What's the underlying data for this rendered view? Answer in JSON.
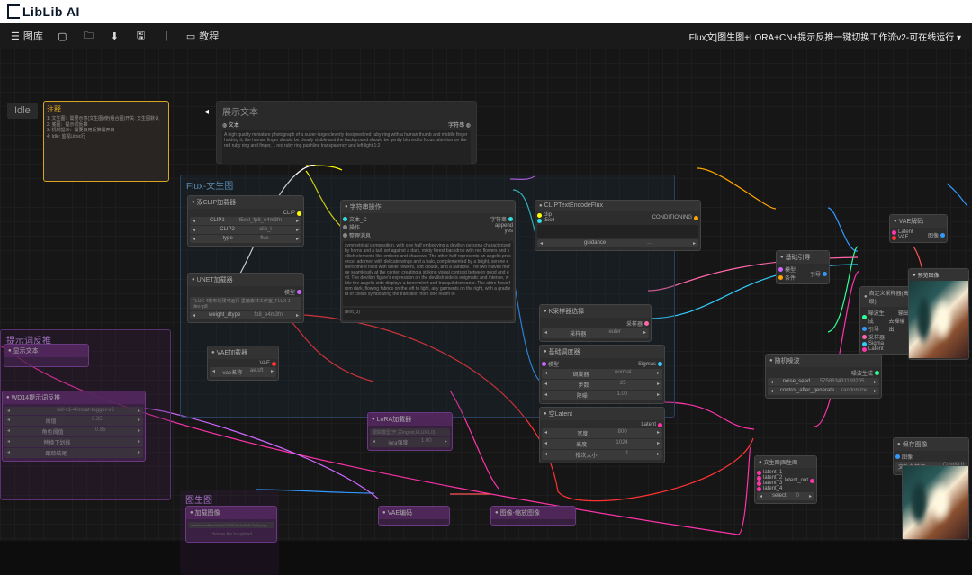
{
  "brand": "LibLib AI",
  "toolbar": {
    "gallery": "图库",
    "tutorial": "教程",
    "title": "Flux文|图生图+LORA+CN+提示反推一键切换工作流v2-可在线运行 ▾"
  },
  "idle": "Idle",
  "notes": {
    "head": "注释",
    "body": "1: 文生图：需要示意(文生图)使(组合图)开关: 文生图默认\n2: 底图：提示词反推\n3: 机制提示：需要启用反推需开启\n4: Idle: 监视Lithic行"
  },
  "display": {
    "title": "展示文本",
    "label": "文本",
    "out": "字符串 ◍",
    "text": "A high quality miniature photograph of a super-large cleverly designed red ruby ring with a human thumb and middle finger holding it, the human finger should be clearly visible and the background should be gently blurred to focus attention on the red ruby ring and finger, 1 red ruby ring pushline transparency and left light,1:2"
  },
  "group": {
    "flux": "Flux-文生图",
    "refl": "提示词反推",
    "imggen": "图生图"
  },
  "clip": {
    "title": "双CLIP加载器",
    "r": "CLIP",
    "rows": [
      [
        "CLIP1",
        "t5xxl_fp8_e4m3fn"
      ],
      [
        "CLIP2",
        "clip_l"
      ],
      [
        "type",
        "flux"
      ]
    ]
  },
  "unet": {
    "title": "UNET加载器",
    "r": "模型",
    "rows": [
      [
        "FLUX-4敬布花残可运行-墨暗森林工作室_FLUX 1-dev-fp8"
      ],
      [
        "weight_dtype",
        "fp8_e4m3fn"
      ]
    ]
  },
  "vae": {
    "title": "VAE加载器",
    "r": "VAE",
    "row": [
      "vae名称",
      "ae.sft"
    ]
  },
  "strop": {
    "title": "字符串操作",
    "out": "字符串",
    "rows": [
      [
        "文本_C",
        ""
      ],
      [
        "操作",
        "append"
      ],
      [
        "整理消息",
        "yes"
      ]
    ],
    "prompt": "symmetrical composition, with one half embodying a devilish persona characterized by horns and a tail, set against a dark, misty forest backdrop with red flowers and hellish elements like embers and shadows. The other half represents an angelic presence, adorned with delicate wings and a halo, complemented by a bright, serene environment filled with white flowers, soft clouds, and a rainbow. The two halves merge seamlessly at the center, creating a striking visual contrast between good and evil. The devilish figure's expression on the devilish side is enigmatic and intense, while the angelic side displays a benevolent and tranquil demeanor. The attire flows from dark, flowing fabrics on the left to light, airy garments on the right, with a gradient of colors symbolizing the transition from one realm to",
    "text_3": "(text_3)"
  },
  "cliptext": {
    "title": "CLIPTextEncodeFlux",
    "out": "CONDITIONING",
    "in": [
      "clip",
      "t5xxl"
    ],
    "row": [
      "guidance",
      "..."
    ]
  },
  "ksamp": {
    "title": "K采样器选择",
    "row": [
      "采样器",
      "euler"
    ]
  },
  "sched": {
    "title": "基础调度器",
    "out": "Sigmas",
    "rows": [
      [
        "调度器",
        "normal"
      ],
      [
        "步数",
        "25"
      ],
      [
        "降噪",
        "1.00"
      ]
    ]
  },
  "empty": {
    "title": "空Latent",
    "out": "Latent",
    "rows": [
      [
        "宽度",
        "800"
      ],
      [
        "高度",
        "1024"
      ],
      [
        "批次大小",
        "1"
      ]
    ]
  },
  "guide": {
    "title": "基础引导",
    "out": "引导",
    "in": [
      "模型",
      "条件"
    ]
  },
  "custom": {
    "title": "自定义采样器(高级)",
    "out": "输出",
    "in": [
      "噪波生成",
      "引导",
      "采样器",
      "Sigma",
      "Latent"
    ],
    "right": [
      "去噪输出"
    ]
  },
  "noise": {
    "title": "随机噪波",
    "out": "噪波生成",
    "rows": [
      [
        "noise_seed",
        "575863431169205"
      ],
      [
        "control_after_generate",
        "randomize"
      ]
    ]
  },
  "latswitch": {
    "title": "文生图|图生图",
    "out": "latent_out",
    "in": [
      "latent_1",
      "latent_2",
      "latent_3",
      "latent_4"
    ],
    "row": [
      "select",
      "0"
    ]
  },
  "vaedec": {
    "title": "VAE解码",
    "out": "图像",
    "in": [
      "Latent",
      "VAE"
    ]
  },
  "save": {
    "title": "保存图像",
    "in": "图像",
    "row": [
      "文件名前缀",
      "ComfyUI"
    ]
  },
  "preview": {
    "title": "预览图像"
  },
  "refl_nodes": {
    "a": {
      "title": "显示文本"
    },
    "b": {
      "title": "WD14提示词反推",
      "rows": [
        [
          "model",
          "wd-v1-4-moat-tagger-v2"
        ],
        [
          "阈值",
          "0.35"
        ],
        [
          "角色阈值",
          "0.85"
        ],
        [
          "替换下划线",
          ""
        ],
        [
          "跟踪结尾",
          ""
        ]
      ]
    }
  },
  "pnodes": {
    "a": {
      "title": "LoRA加载器",
      "rows": [
        [
          "跟踪模型(开,关lognot,FLUX1.0)",
          "1.00"
        ],
        [
          "lora强度",
          "1.00"
        ]
      ]
    },
    "b": {
      "title": "加载图像",
      "row": [
        "woddoood8ee16e060720914b1e804c7add.png"
      ],
      "hint": "choose file to upload"
    },
    "c": {
      "title": "VAE编码"
    },
    "d": {
      "title": "图像-缩放图像"
    }
  }
}
